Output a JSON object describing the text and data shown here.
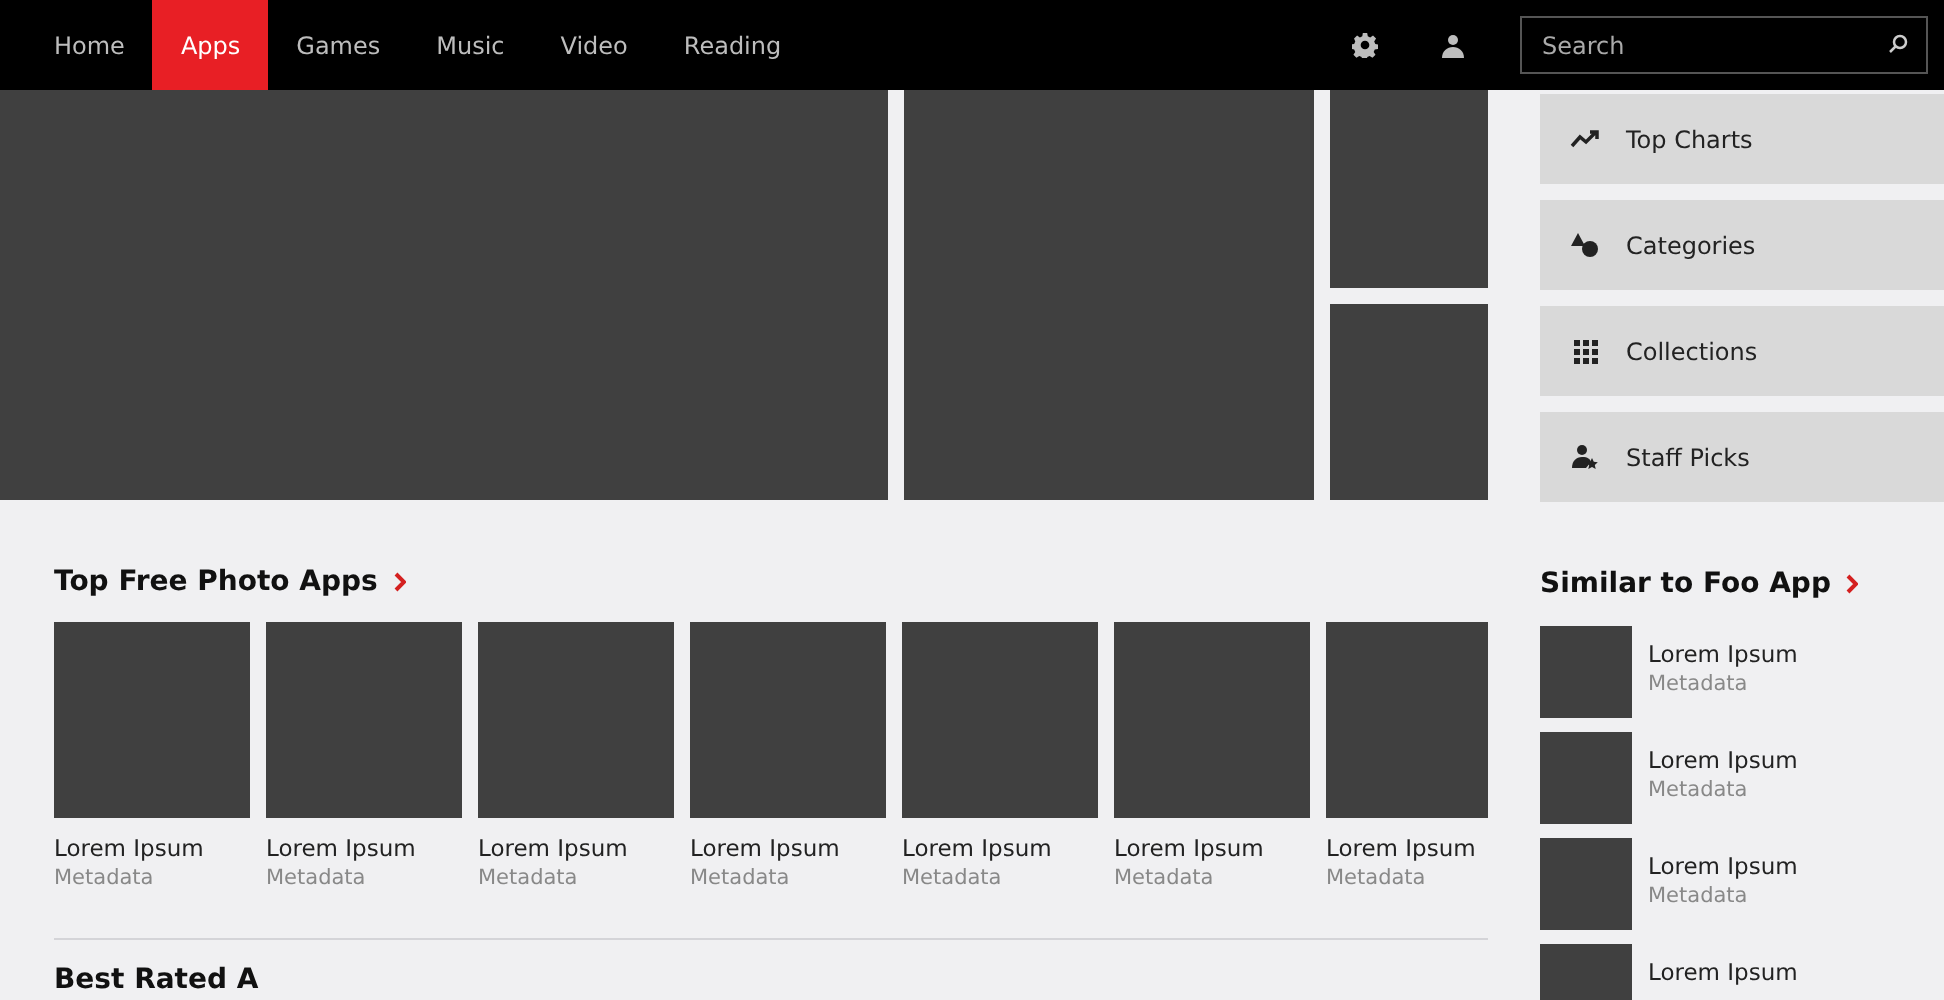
{
  "nav": {
    "tabs": [
      {
        "label": "Home",
        "selected": false
      },
      {
        "label": "Apps",
        "selected": true
      },
      {
        "label": "Games",
        "selected": false
      },
      {
        "label": "Music",
        "selected": false
      },
      {
        "label": "Video",
        "selected": false
      },
      {
        "label": "Reading",
        "selected": false
      }
    ],
    "search": {
      "placeholder": "Search"
    }
  },
  "side_menu": [
    {
      "kind": "chart",
      "label": "Top Charts"
    },
    {
      "kind": "shapes",
      "label": "Categories"
    },
    {
      "kind": "grid",
      "label": "Collections"
    },
    {
      "kind": "person",
      "label": "Staff Picks"
    }
  ],
  "top_free": {
    "title": "Top Free Photo Apps",
    "items": [
      {
        "name": "Lorem Ipsum",
        "meta": "Metadata"
      },
      {
        "name": "Lorem Ipsum",
        "meta": "Metadata"
      },
      {
        "name": "Lorem Ipsum",
        "meta": "Metadata"
      },
      {
        "name": "Lorem Ipsum",
        "meta": "Metadata"
      },
      {
        "name": "Lorem Ipsum",
        "meta": "Metadata"
      },
      {
        "name": "Lorem Ipsum",
        "meta": "Metadata"
      },
      {
        "name": "Lorem Ipsum",
        "meta": "Metadata"
      }
    ]
  },
  "best_rated": {
    "title": "Best Rated A"
  },
  "similar": {
    "title": "Similar to Foo App",
    "items": [
      {
        "name": "Lorem Ipsum",
        "meta": "Metadata"
      },
      {
        "name": "Lorem Ipsum",
        "meta": "Metadata"
      },
      {
        "name": "Lorem Ipsum",
        "meta": "Metadata"
      },
      {
        "name": "Lorem Ipsum"
      }
    ]
  }
}
